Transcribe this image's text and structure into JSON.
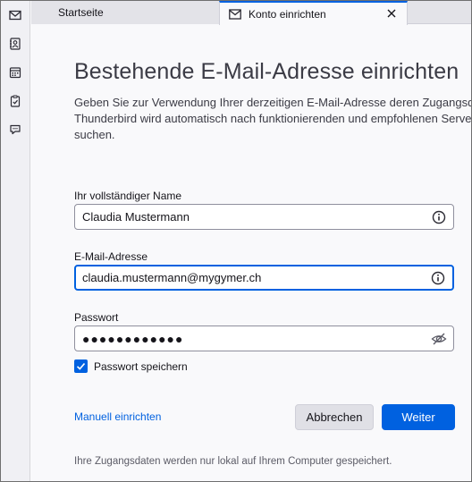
{
  "tabs": [
    {
      "label": "Startseite"
    },
    {
      "label": "Konto einrichten"
    }
  ],
  "page": {
    "title": "Bestehende E-Mail-Adresse einrichten",
    "intro_lines": [
      "Geben Sie zur Verwendung Ihrer derzeitigen E-Mail-Adresse deren Zugangsd",
      "Thunderbird wird automatisch nach funktionierenden und empfohlenen Serve",
      "suchen."
    ]
  },
  "form": {
    "name_label": "Ihr vollständiger Name",
    "name_value": "Claudia Mustermann",
    "email_label": "E-Mail-Adresse",
    "email_value": "claudia.mustermann@mygymer.ch",
    "password_label": "Passwort",
    "password_value": "●●●●●●●●●●●●",
    "remember_label": "Passwort speichern",
    "remember_checked": true
  },
  "actions": {
    "manual_link": "Manuell einrichten",
    "cancel_label": "Abbrechen",
    "next_label": "Weiter"
  },
  "footer": {
    "note": "Ihre Zugangsdaten werden nur lokal auf Ihrem Computer gespeichert."
  },
  "colors": {
    "accent": "#0061e0",
    "background": "#f9f9fb"
  },
  "icons": {
    "spaces": [
      "mail-icon",
      "address-book-icon",
      "calendar-icon",
      "tasks-icon",
      "chat-icon"
    ],
    "tab_active": "envelope-icon",
    "tab_close": "close-icon",
    "field_info": "info-icon",
    "password_toggle": "eye-slash-icon",
    "checkbox": "checkmark-icon"
  }
}
